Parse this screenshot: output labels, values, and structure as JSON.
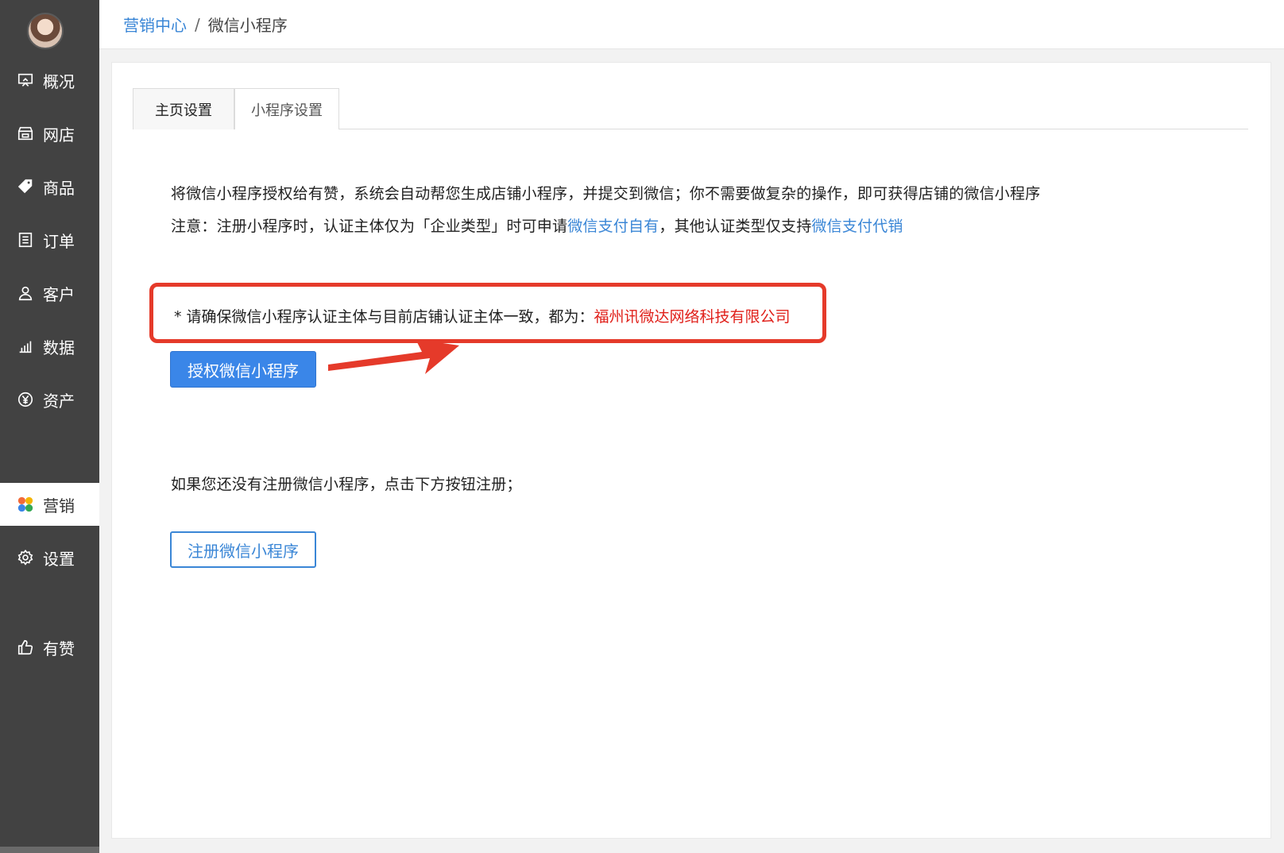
{
  "sidebar": {
    "items": [
      {
        "label": "概况",
        "icon": "overview-icon"
      },
      {
        "label": "网店",
        "icon": "store-icon"
      },
      {
        "label": "商品",
        "icon": "tag-icon"
      },
      {
        "label": "订单",
        "icon": "order-icon"
      },
      {
        "label": "客户",
        "icon": "user-icon"
      },
      {
        "label": "数据",
        "icon": "chart-icon"
      },
      {
        "label": "资产",
        "icon": "yuan-icon"
      },
      {
        "label": "营销",
        "icon": "marketing-icon"
      },
      {
        "label": "设置",
        "icon": "gear-icon"
      },
      {
        "label": "有赞",
        "icon": "thumbs-up-icon"
      }
    ],
    "active": "营销"
  },
  "header": {
    "breadcrumb_parent": "营销中心",
    "breadcrumb_separator": "/",
    "breadcrumb_current": "微信小程序"
  },
  "tabs": [
    "主页设置",
    "小程序设置"
  ],
  "content": {
    "line1": "将微信小程序授权给有赞，系统会自动帮您生成店铺小程序，并提交到微信；你不需要做复杂的操作，即可获得店铺的微信小程序",
    "line2_prefix": "注意：注册小程序时，认证主体仅为「企业类型」时可申请",
    "line2_link1": "微信支付自有",
    "line2_middle": "，其他认证类型仅支持",
    "line2_link2": "微信支付代销",
    "notice_prefix": "* 请确保微信小程序认证主体与目前店铺认证主体一致，都为：",
    "notice_company": "福州讯微达网络科技有限公司",
    "authorize_button": "授权微信小程序",
    "register_hint": "如果您还没有注册微信小程序，点击下方按钮注册；",
    "register_button": "注册微信小程序"
  },
  "colors": {
    "sidebar_bg": "#424242",
    "accent_blue": "#3a86d6",
    "primary_button": "#3a86e8",
    "annotation_red": "#e53a2a"
  }
}
